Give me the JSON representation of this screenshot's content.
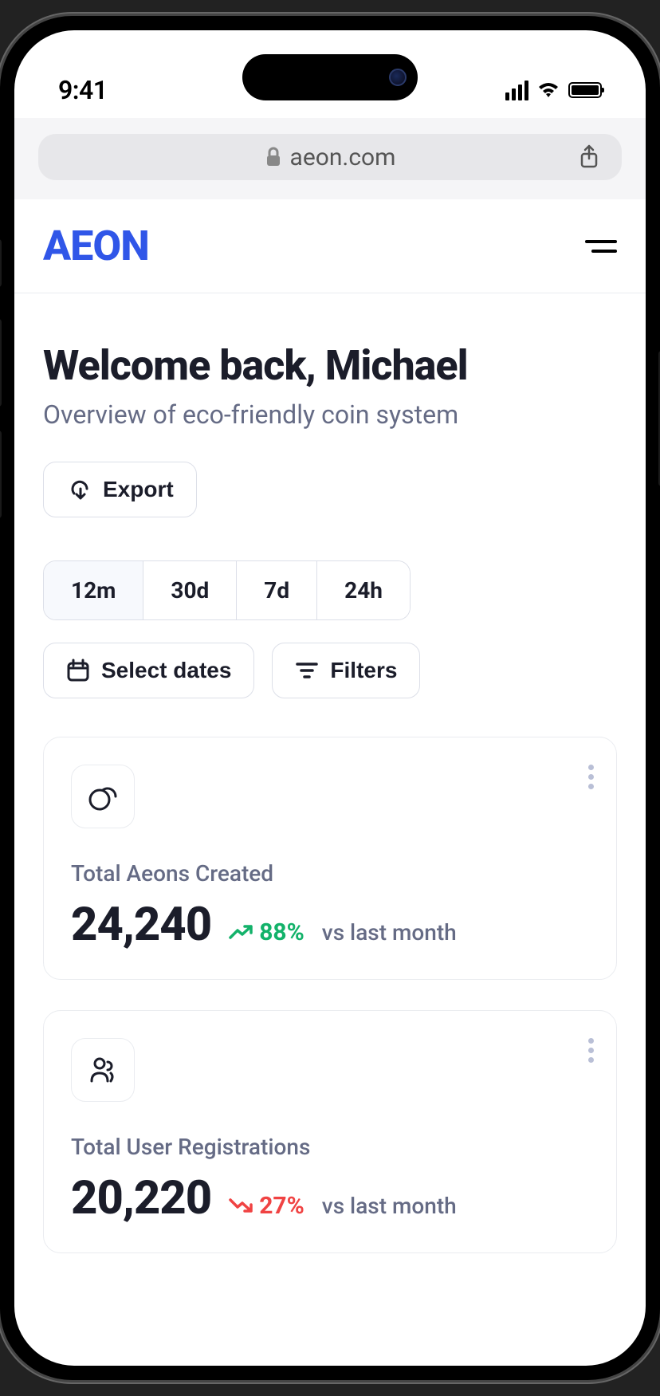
{
  "status_bar": {
    "time": "9:41"
  },
  "browser": {
    "domain": "aeon.com"
  },
  "header": {
    "logo": "AEON"
  },
  "page": {
    "title": "Welcome back, Michael",
    "subtitle": "Overview of eco-friendly coin system"
  },
  "actions": {
    "export": "Export",
    "select_dates": "Select dates",
    "filters": "Filters"
  },
  "time_tabs": [
    "12m",
    "30d",
    "7d",
    "24h"
  ],
  "time_tabs_active": "12m",
  "cards": [
    {
      "label": "Total Aeons Created",
      "value": "24,240",
      "trend_direction": "up",
      "trend_percent": "88%",
      "compare": "vs last month"
    },
    {
      "label": "Total User Registrations",
      "value": "20,220",
      "trend_direction": "down",
      "trend_percent": "27%",
      "compare": "vs last month"
    }
  ]
}
